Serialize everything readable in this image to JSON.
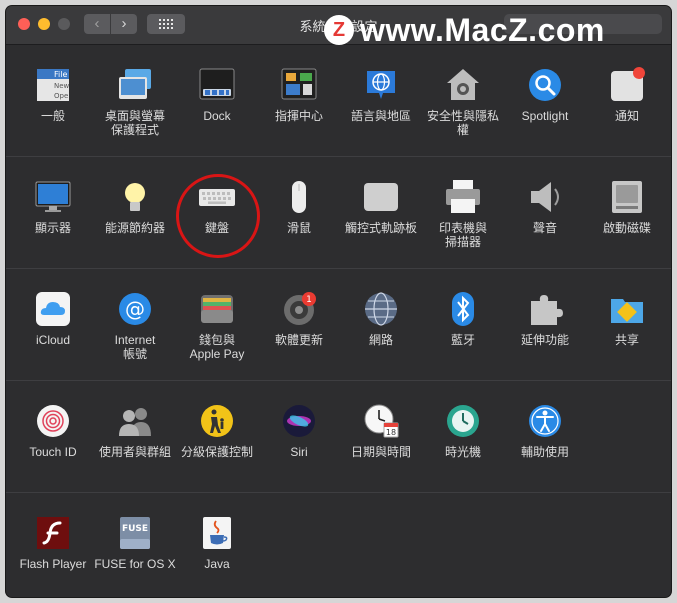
{
  "window": {
    "title": "系統偏好設定",
    "nav_back": "‹",
    "nav_forward": "›"
  },
  "watermark": {
    "logo": "Z",
    "text": "www.MacZ.com"
  },
  "rows": [
    {
      "items": [
        {
          "label": "一般",
          "icon": "general-icon"
        },
        {
          "label": "桌面與螢幕\n保護程式",
          "icon": "desktop-screensaver-icon"
        },
        {
          "label": "Dock",
          "icon": "dock-icon"
        },
        {
          "label": "指揮中心",
          "icon": "mission-control-icon"
        },
        {
          "label": "語言與地區",
          "icon": "language-region-icon"
        },
        {
          "label": "安全性與隱私權",
          "icon": "security-privacy-icon"
        },
        {
          "label": "Spotlight",
          "icon": "spotlight-icon"
        },
        {
          "label": "通知",
          "icon": "notifications-icon"
        }
      ]
    },
    {
      "items": [
        {
          "label": "顯示器",
          "icon": "displays-icon"
        },
        {
          "label": "能源節約器",
          "icon": "energy-saver-icon"
        },
        {
          "label": "鍵盤",
          "icon": "keyboard-icon"
        },
        {
          "label": "滑鼠",
          "icon": "mouse-icon"
        },
        {
          "label": "觸控式軌跡板",
          "icon": "trackpad-icon"
        },
        {
          "label": "印表機與\n掃描器",
          "icon": "printers-scanners-icon"
        },
        {
          "label": "聲音",
          "icon": "sound-icon"
        },
        {
          "label": "啟動磁碟",
          "icon": "startup-disk-icon"
        }
      ]
    },
    {
      "items": [
        {
          "label": "iCloud",
          "icon": "icloud-icon"
        },
        {
          "label": "Internet\n帳號",
          "icon": "internet-accounts-icon"
        },
        {
          "label": "錢包與\nApple Pay",
          "icon": "wallet-applepay-icon"
        },
        {
          "label": "軟體更新",
          "icon": "software-update-icon",
          "badge": "1"
        },
        {
          "label": "網路",
          "icon": "network-icon"
        },
        {
          "label": "藍牙",
          "icon": "bluetooth-icon"
        },
        {
          "label": "延伸功能",
          "icon": "extensions-icon"
        },
        {
          "label": "共享",
          "icon": "sharing-icon"
        }
      ]
    },
    {
      "items": [
        {
          "label": "Touch ID",
          "icon": "touch-id-icon"
        },
        {
          "label": "使用者與群組",
          "icon": "users-groups-icon"
        },
        {
          "label": "分級保護控制",
          "icon": "parental-controls-icon"
        },
        {
          "label": "Siri",
          "icon": "siri-icon"
        },
        {
          "label": "日期與時間",
          "icon": "date-time-icon",
          "calendar_day": "18"
        },
        {
          "label": "時光機",
          "icon": "time-machine-icon"
        },
        {
          "label": "輔助使用",
          "icon": "accessibility-icon"
        }
      ]
    },
    {
      "items": [
        {
          "label": "Flash Player",
          "icon": "flash-player-icon"
        },
        {
          "label": "FUSE for OS X",
          "icon": "fuse-icon",
          "icon_text": "FUSE"
        },
        {
          "label": "Java",
          "icon": "java-icon"
        }
      ]
    }
  ],
  "general_icon_text": [
    "File",
    "New",
    "Ope"
  ],
  "accent": {
    "highlight_circle": "#d91515"
  }
}
